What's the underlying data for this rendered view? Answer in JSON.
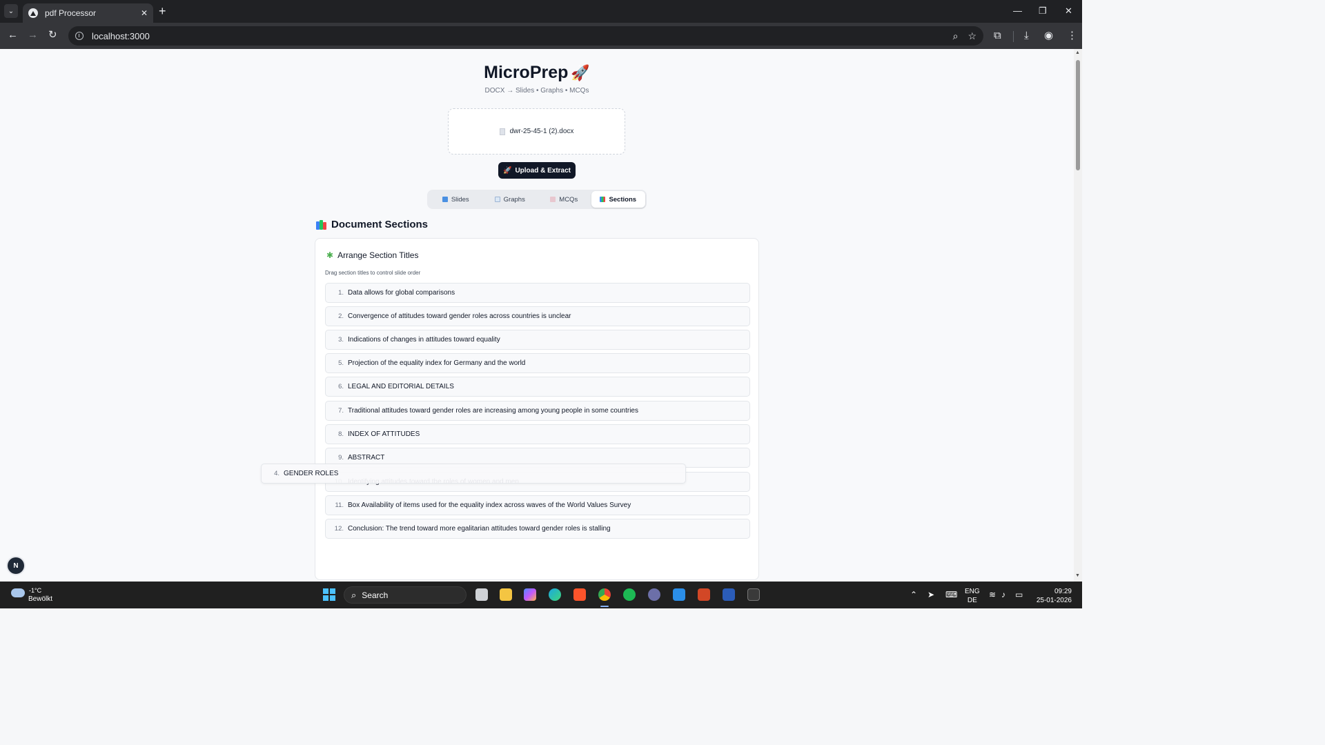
{
  "browser": {
    "tab_title": "pdf Processor",
    "url": "localhost:3000"
  },
  "app": {
    "title": "MicroPrep",
    "subtitle": "DOCX → Slides • Graphs • MCQs",
    "file_name": "dwr-25-45-1 (2).docx",
    "upload_button": "Upload & Extract"
  },
  "tabs": [
    {
      "label": "Slides",
      "icon": "slides-icon",
      "active": false
    },
    {
      "label": "Graphs",
      "icon": "graph-icon",
      "active": false
    },
    {
      "label": "MCQs",
      "icon": "mcq-icon",
      "active": false
    },
    {
      "label": "Sections",
      "icon": "sections-icon",
      "active": true
    }
  ],
  "sections": {
    "heading": "Document Sections",
    "card_title": "Arrange Section Titles",
    "hint": "Drag section titles to control slide order",
    "items": [
      {
        "num": "1.",
        "label": "Data allows for global comparisons"
      },
      {
        "num": "2.",
        "label": "Convergence of attitudes toward gender roles across countries is unclear"
      },
      {
        "num": "3.",
        "label": "Indications of changes in attitudes toward equality"
      },
      {
        "num": "5.",
        "label": "Projection of the equality index for Germany and the world"
      },
      {
        "num": "6.",
        "label": "LEGAL AND EDITORIAL DETAILS"
      },
      {
        "num": "7.",
        "label": "Traditional attitudes toward gender roles are increasing among young people in some countries"
      },
      {
        "num": "8.",
        "label": "INDEX OF ATTITUDES"
      },
      {
        "num": "9.",
        "label": "ABSTRACT"
      },
      {
        "num": "10.",
        "label": "Identifying attitudes toward the roles of women and men"
      },
      {
        "num": "11.",
        "label": "Box Availability of items used for the equality index across waves of the World Values Survey"
      },
      {
        "num": "12.",
        "label": "Conclusion: The trend toward more egalitarian attitudes toward gender roles is stalling"
      }
    ],
    "dragging": {
      "num": "4.",
      "label": "GENDER ROLES"
    }
  },
  "next_badge": "N",
  "taskbar": {
    "temperature": "-1°C",
    "weather": "Bewölkt",
    "search_placeholder": "Search",
    "language_top": "ENG",
    "language_bottom": "DE",
    "time": "09:29",
    "date": "25-01-2026"
  },
  "colors": {
    "accent_dark": "#111827",
    "page_background": "#f8f9fb",
    "chrome_dark": "#202124",
    "tab_active_bg": "#ffffff"
  }
}
